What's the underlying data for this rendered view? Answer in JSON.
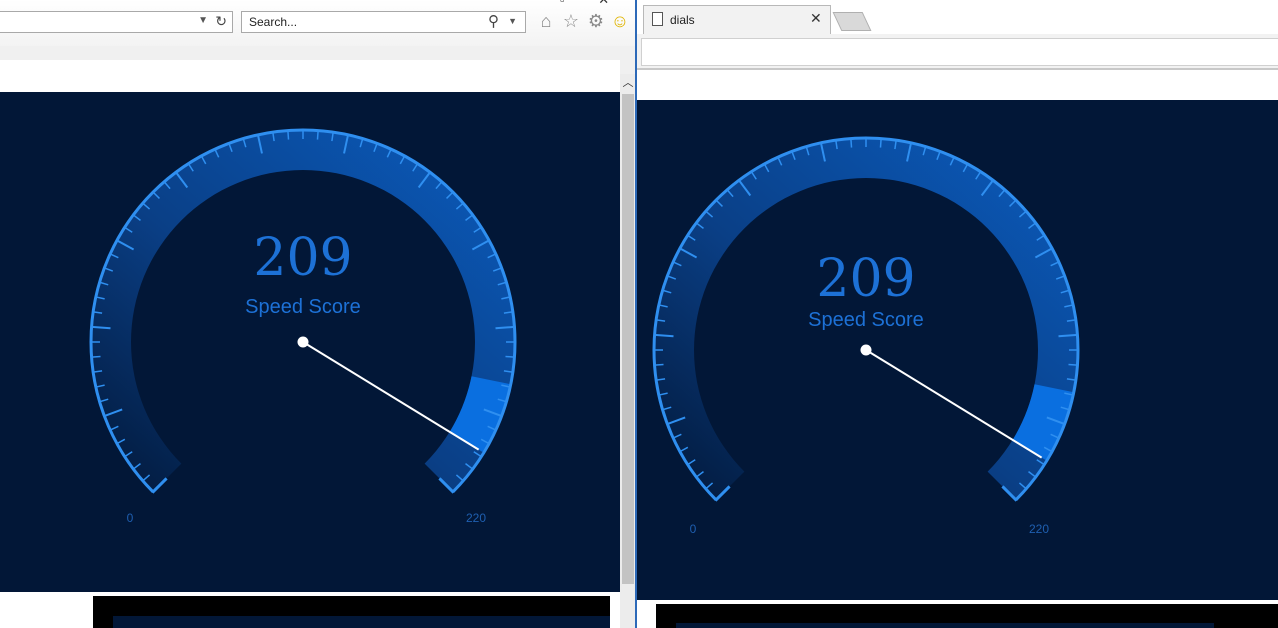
{
  "left_window": {
    "search_placeholder": "Search...",
    "toolbar_icons": [
      "home-icon",
      "star-icon",
      "gear-icon",
      "smiley-icon"
    ]
  },
  "right_window": {
    "tab_title": "dials",
    "tab_close": "✕"
  },
  "gauges": [
    {
      "value": 209,
      "value_text": "209",
      "label": "Speed Score",
      "min": 0,
      "max": 220,
      "min_label": "0",
      "max_label": "220"
    },
    {
      "value": 209,
      "value_text": "209",
      "label": "Speed Score",
      "min": 0,
      "max": 220,
      "min_label": "0",
      "max_label": "220"
    }
  ],
  "colors": {
    "panel_bg": "#021737",
    "gauge_accent": "#2f8ff0",
    "gauge_fill": "#0a6fe0",
    "text_blue": "#1d71d6",
    "needle": "#ffffff"
  }
}
